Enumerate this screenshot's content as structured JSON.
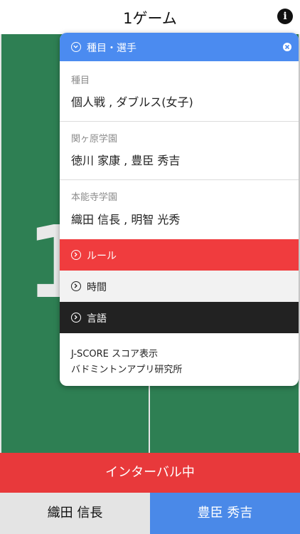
{
  "header": {
    "title": "1ゲーム",
    "info_icon": "i"
  },
  "court": {
    "big_digit": "1"
  },
  "popover": {
    "head_label": "種目・選手",
    "sections": [
      {
        "label": "種目",
        "value": "個人戦 , ダブルス(女子)"
      },
      {
        "label": "関ヶ原学園",
        "value": "徳川 家康 , 豊臣 秀吉"
      },
      {
        "label": "本能寺学園",
        "value": "織田 信長 , 明智 光秀"
      }
    ],
    "menu": {
      "rules": "ルール",
      "time": "時間",
      "language": "言語"
    },
    "footer_line1": "J-SCORE スコア表示",
    "footer_line2": "バドミントンアプリ研究所"
  },
  "interval_label": "インターバル中",
  "players": {
    "left": "織田 信長",
    "right": "豊臣 秀吉"
  },
  "colors": {
    "court_green": "#2e7f53",
    "accent_blue": "#4b8bf0",
    "rules_red": "#f03c3e",
    "interval_red": "#e8393b",
    "lang_black": "#222222"
  },
  "icons": {
    "head": "chevron-down-circle-icon",
    "close": "close-circle-icon",
    "menu": "chevron-right-circle-icon",
    "info": "info-icon"
  }
}
